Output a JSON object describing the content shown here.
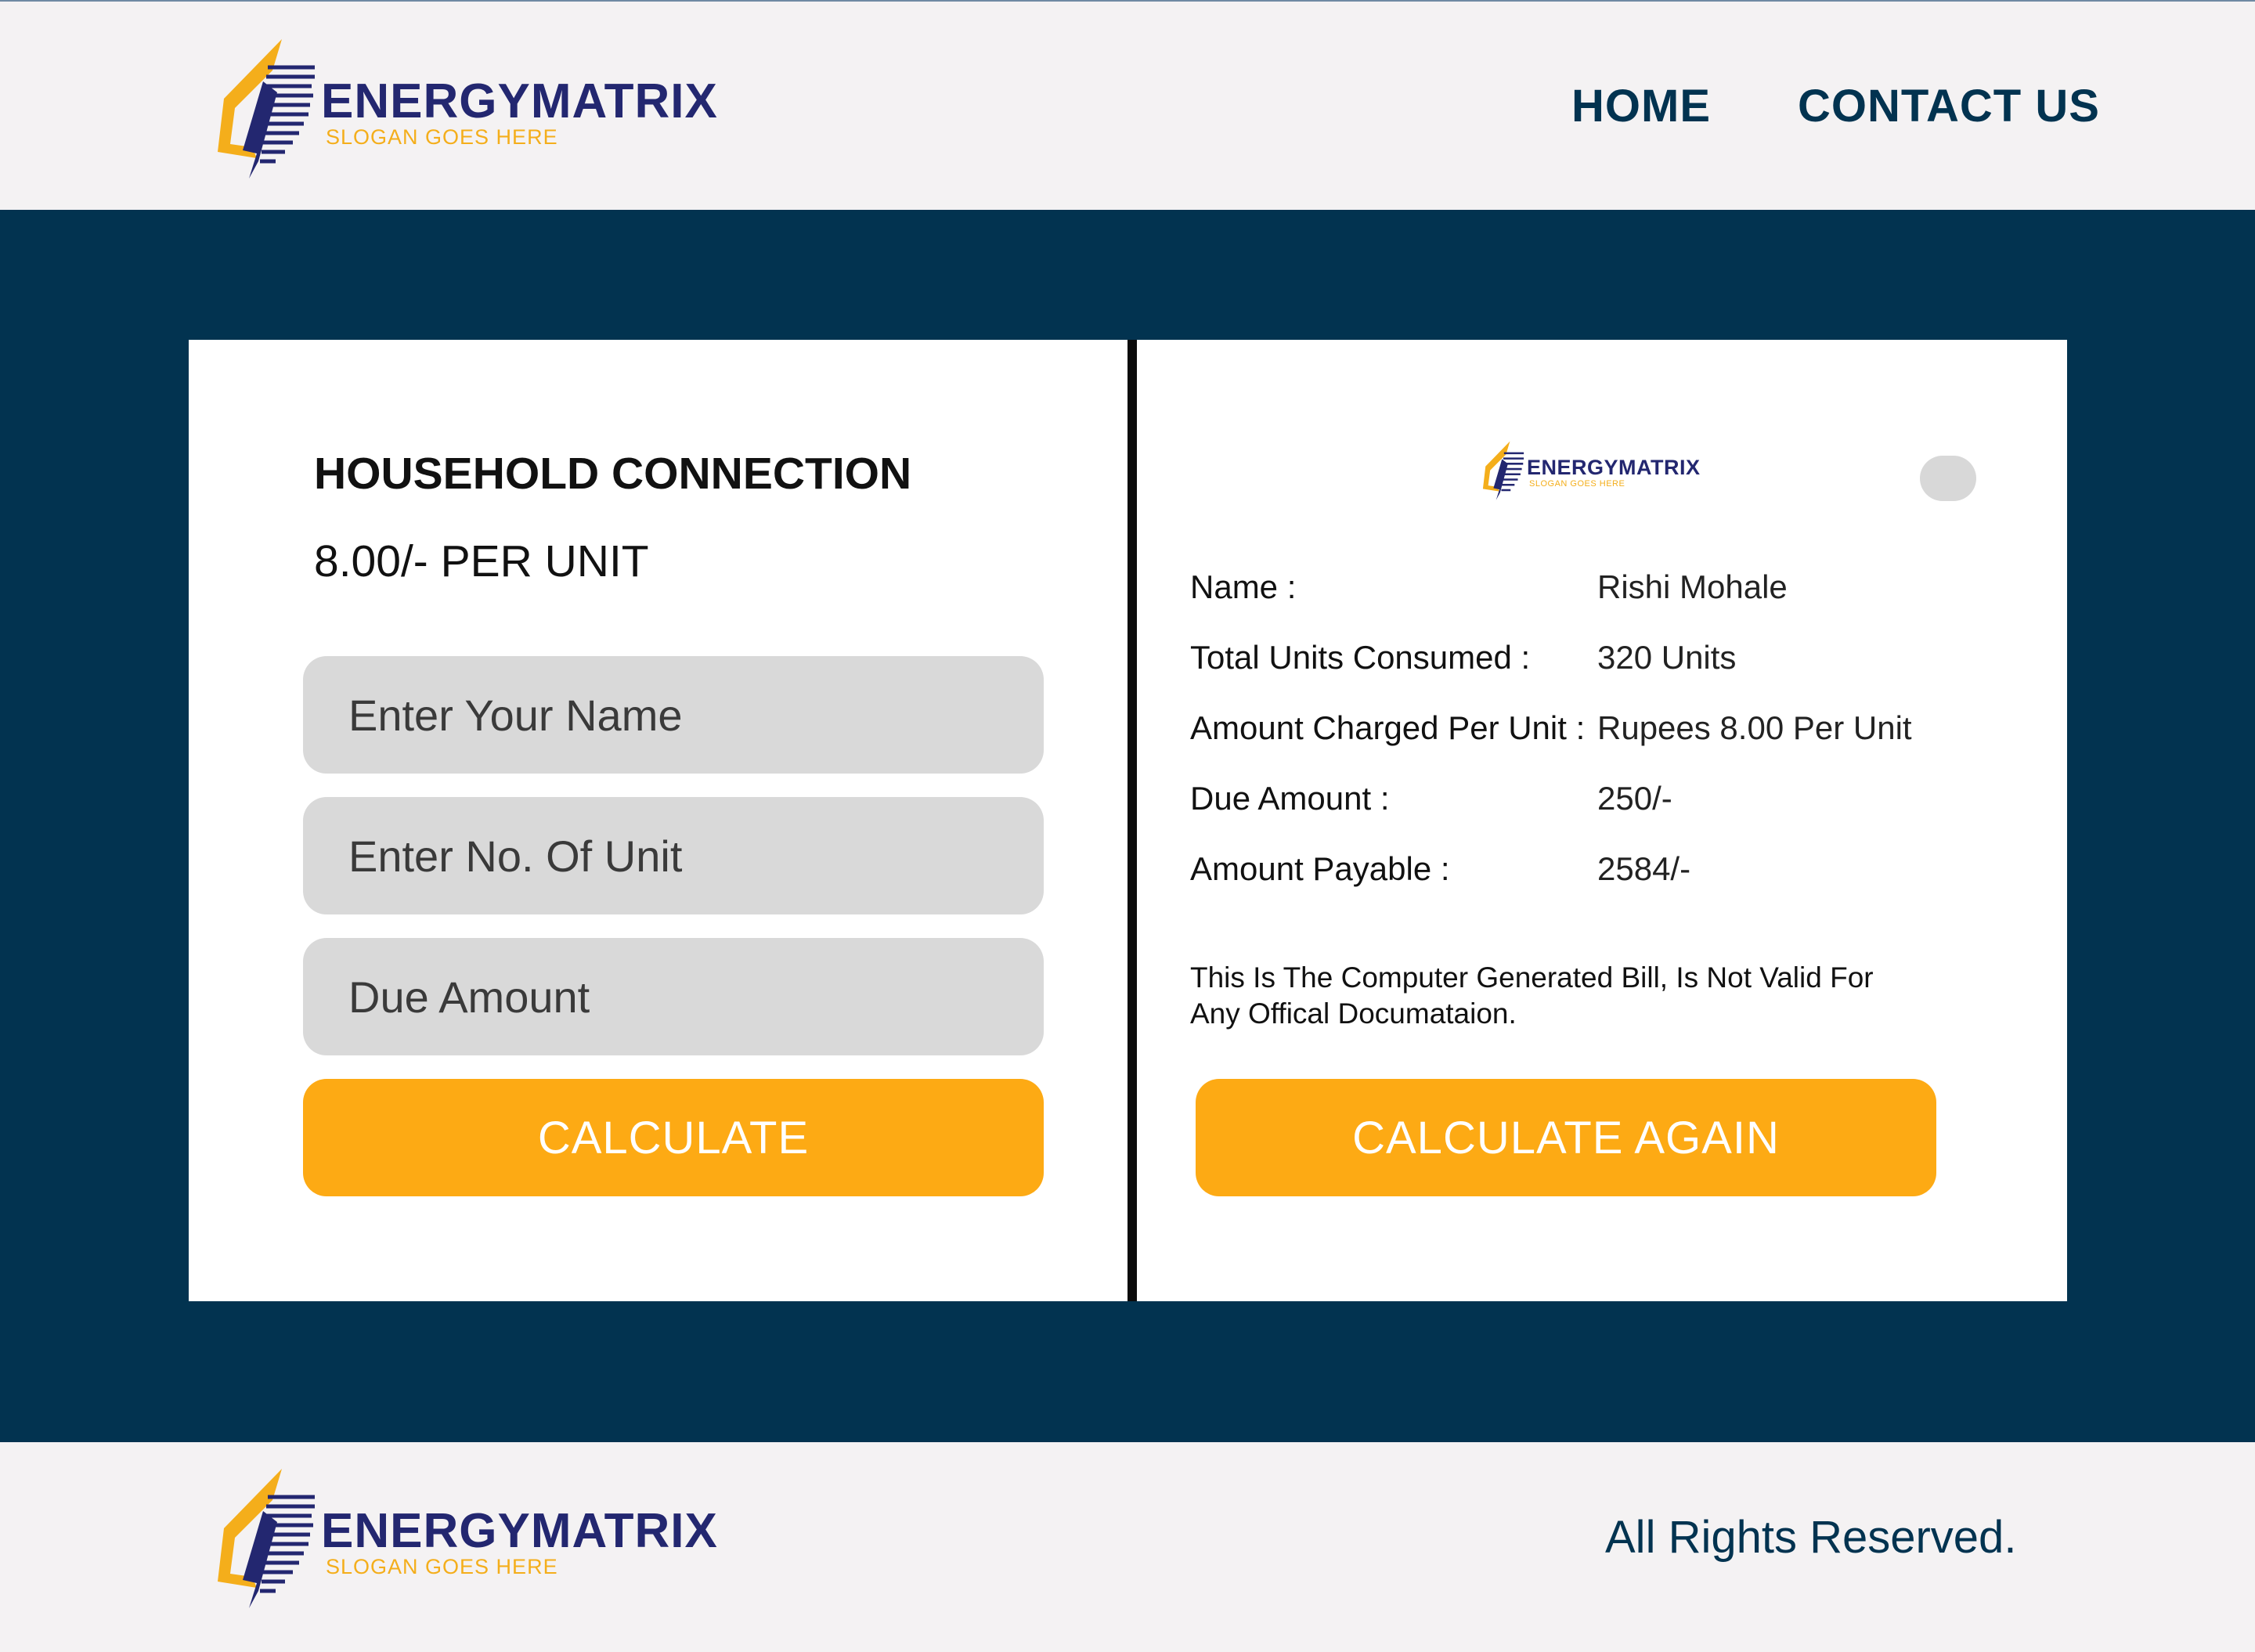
{
  "brand": {
    "name": "ENERGYMATRIX",
    "slogan": "SLOGAN GOES HERE",
    "colors": {
      "navy": "#232770",
      "accent": "#f4ae1b"
    }
  },
  "nav": {
    "items": [
      {
        "label": "HOME"
      },
      {
        "label": "CONTACT US"
      }
    ]
  },
  "form": {
    "title": "HOUSEHOLD CONNECTION",
    "rate": "8.00/- PER UNIT",
    "name_placeholder": "Enter Your Name",
    "units_placeholder": "Enter No. Of Unit",
    "due_placeholder": "Due Amount",
    "button_label": "CALCULATE"
  },
  "bill": {
    "rows": [
      {
        "label": "Name :",
        "value": "Rishi Mohale"
      },
      {
        "label": "Total Units Consumed :",
        "value": "320 Units"
      },
      {
        "label": "Amount Charged Per Unit :",
        "value": "Rupees 8.00  Per Unit"
      },
      {
        "label": "Due Amount :",
        "value": "250/-"
      },
      {
        "label": "Amount Payable :",
        "value": "2584/-"
      }
    ],
    "notice": "This Is The Computer Generated Bill, Is Not Valid For Any Offical Documataion.",
    "button_label": "CALCULATE AGAIN"
  },
  "footer": {
    "rights": "All Rights Reserved."
  },
  "colors": {
    "background": "#023350",
    "button": "#fdaa14",
    "input": "#d9d9d9"
  },
  "icons": [
    "lightning-bolt-logo-icon",
    "toggle-icon"
  ]
}
